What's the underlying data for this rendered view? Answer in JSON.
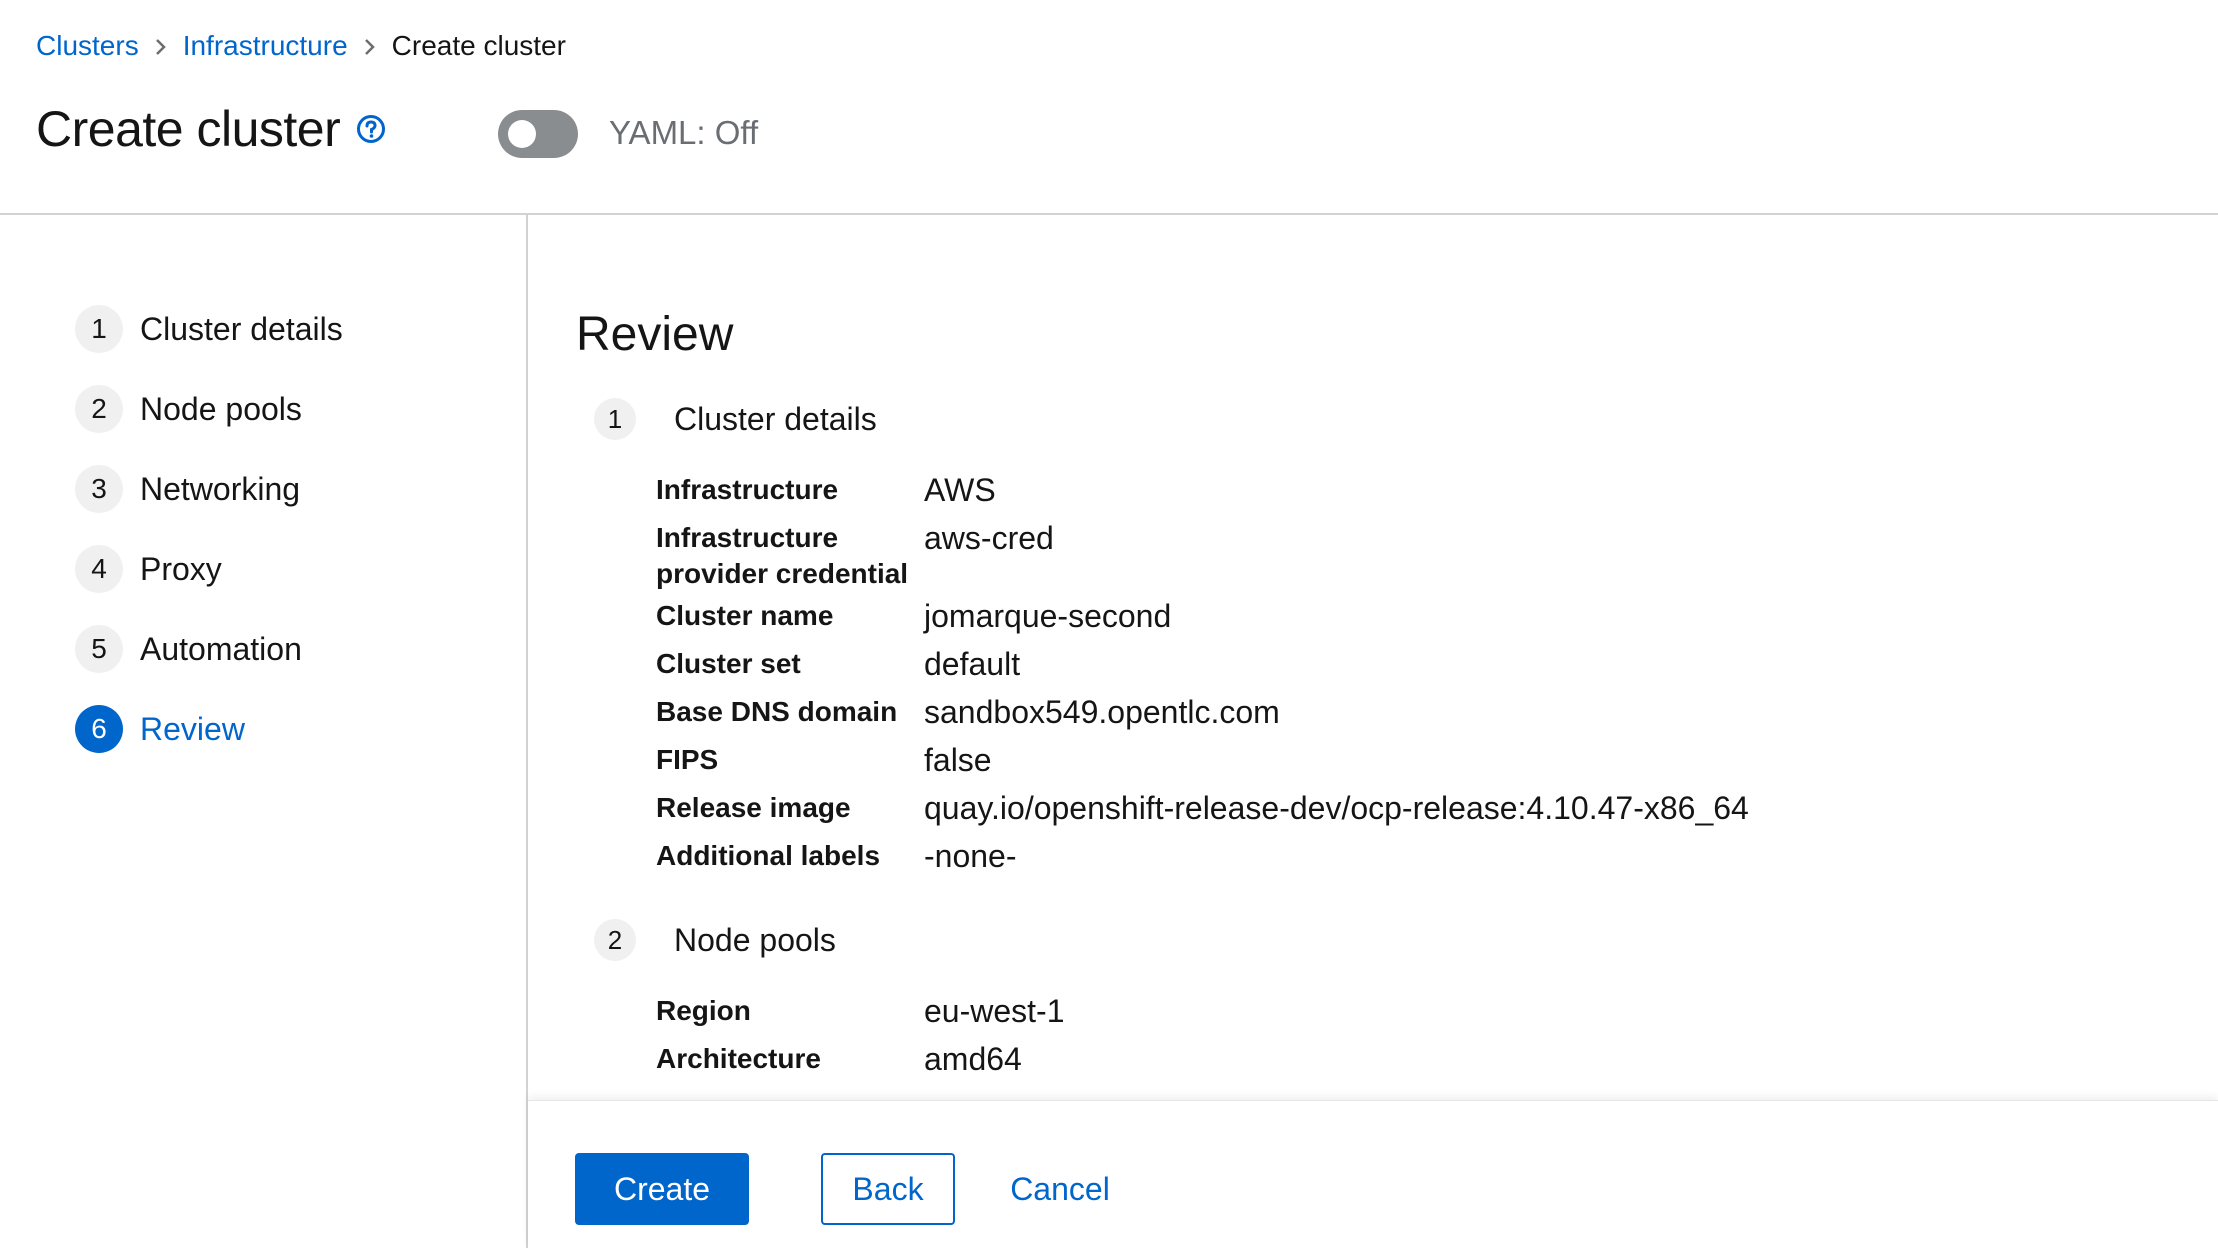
{
  "breadcrumb": {
    "items": [
      {
        "label": "Clusters"
      },
      {
        "label": "Infrastructure"
      },
      {
        "label": "Create cluster"
      }
    ]
  },
  "header": {
    "title": "Create cluster",
    "yaml_toggle_label": "YAML: Off"
  },
  "wizard_nav": {
    "steps": [
      {
        "num": "1",
        "label": "Cluster details"
      },
      {
        "num": "2",
        "label": "Node pools"
      },
      {
        "num": "3",
        "label": "Networking"
      },
      {
        "num": "4",
        "label": "Proxy"
      },
      {
        "num": "5",
        "label": "Automation"
      },
      {
        "num": "6",
        "label": "Review",
        "active": true
      }
    ]
  },
  "review": {
    "title": "Review",
    "sections": [
      {
        "num": "1",
        "label": "Cluster details",
        "rows": [
          {
            "term": "Infrastructure",
            "value": "AWS"
          },
          {
            "term_line1": "Infrastructure",
            "term_line2": "provider credential",
            "value": "aws-cred"
          },
          {
            "term": "Cluster name",
            "value": "jomarque-second"
          },
          {
            "term": "Cluster set",
            "value": "default"
          },
          {
            "term": "Base DNS domain",
            "value": "sandbox549.opentlc.com"
          },
          {
            "term": "FIPS",
            "value": "false"
          },
          {
            "term": "Release image",
            "value": "quay.io/openshift-release-dev/ocp-release:4.10.47-x86_64"
          },
          {
            "term": "Additional labels",
            "value": "-none-"
          }
        ]
      },
      {
        "num": "2",
        "label": "Node pools",
        "rows": [
          {
            "term": "Region",
            "value": "eu-west-1"
          },
          {
            "term": "Architecture",
            "value": "amd64"
          }
        ]
      }
    ]
  },
  "footer": {
    "create_label": "Create",
    "back_label": "Back",
    "cancel_label": "Cancel"
  },
  "colors": {
    "link": "#0066cc",
    "primary": "#0066cc",
    "toggle_off": "#8a8d90"
  }
}
